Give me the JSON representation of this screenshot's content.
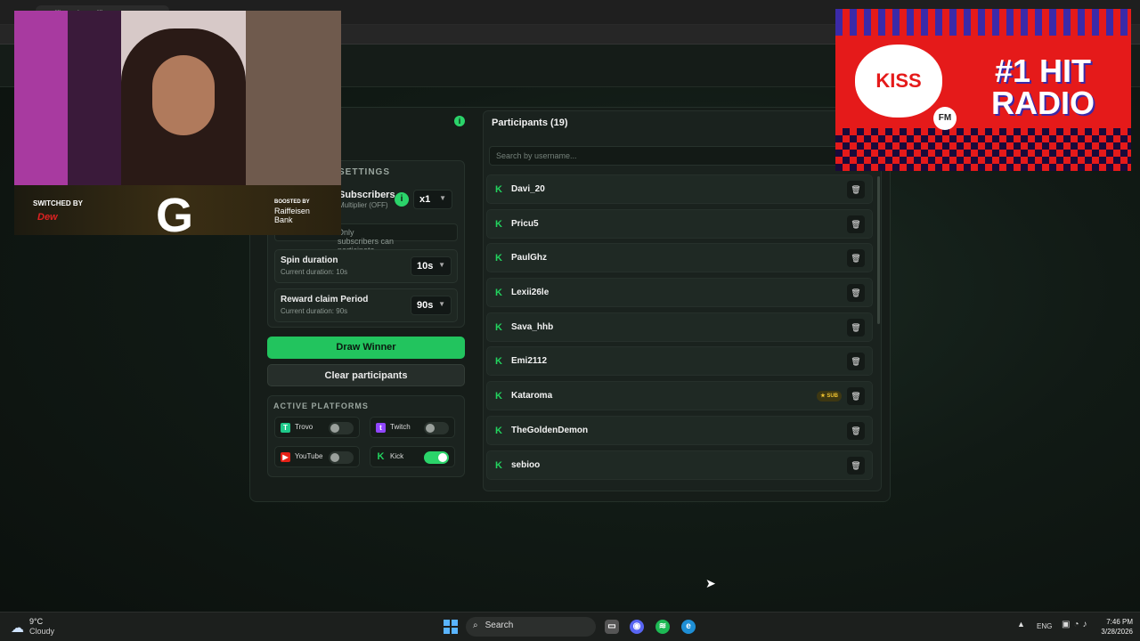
{
  "browser": {
    "tab_title": "RaffleHub Raffle"
  },
  "raffle": {
    "settings_title": "SETTINGS",
    "subscribers": {
      "label": "Subscribers",
      "sub": "Multiplier (OFF)",
      "multiplier": "x1",
      "hint": "Only subscribers can participate"
    },
    "spin": {
      "label": "Spin duration",
      "sub": "Current duration: 10s",
      "value": "10s"
    },
    "reward": {
      "label": "Reward claim Period",
      "sub": "Current duration: 90s",
      "value": "90s"
    },
    "draw_label": "Draw Winner",
    "clear_label": "Clear participants",
    "platforms_title": "ACTIVE PLATFORMS",
    "platforms": [
      {
        "name": "Trovo",
        "on": false,
        "color": "#1ec98a"
      },
      {
        "name": "Twitch",
        "on": false,
        "color": "#9146ff"
      },
      {
        "name": "YouTube",
        "on": false,
        "color": "#e62117"
      },
      {
        "name": "Kick",
        "on": true,
        "color": "#22d35e"
      }
    ]
  },
  "participants": {
    "title": "Participants (19)",
    "search_placeholder": "Search by username...",
    "list": [
      {
        "name": "Davi_20",
        "badge": ""
      },
      {
        "name": "Pricu5",
        "badge": ""
      },
      {
        "name": "PaulGhz",
        "badge": ""
      },
      {
        "name": "Lexii26le",
        "badge": ""
      },
      {
        "name": "Sava_hhb",
        "badge": ""
      },
      {
        "name": "Emi2112",
        "badge": ""
      },
      {
        "name": "Kataroma",
        "badge": "★ SUB"
      },
      {
        "name": "TheGoldenDemon",
        "badge": ""
      },
      {
        "name": "sebioo",
        "badge": ""
      }
    ]
  },
  "overlay": {
    "switched_by": "SWITCHED BY",
    "sponsor": "Dew",
    "boosted_by": "BOOSTED BY",
    "bank_line1": "Raiffeisen",
    "bank_line2": "Bank",
    "logo": "G"
  },
  "ad": {
    "brand": "KISS",
    "fm": "FM",
    "slogan": "#1 HIT RADIO"
  },
  "taskbar": {
    "temp": "9°C",
    "condition": "Cloudy",
    "search": "Search",
    "lang": "ENG",
    "time": "7:46 PM",
    "date": "3/28/2026"
  },
  "colors": {
    "accent": "#22c45e",
    "kick_green": "#22d35e",
    "sub_badge": "#f0c330"
  }
}
